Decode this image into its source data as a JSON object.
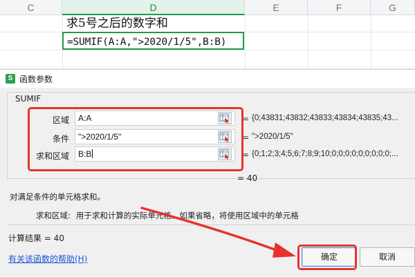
{
  "sheet": {
    "columns": [
      "C",
      "D",
      "E",
      "F",
      "G"
    ],
    "active_column": "D",
    "d1_text": "求5号之后的数字和",
    "d2_formula": "=SUMIF(A:A,\">2020/1/5\",B:B)"
  },
  "dialog": {
    "app_icon_letter": "S",
    "title": "函数参数",
    "function_name": "SUMIF",
    "args": [
      {
        "label": "区域",
        "value": "A:A",
        "preview": "{0;43831;43832;43833;43834;43835;43..."
      },
      {
        "label": "条件",
        "value": "\">2020/1/5\"",
        "preview": "\">2020/1/5\""
      },
      {
        "label": "求和区域",
        "value": "B:B",
        "preview": "{0;1;2;3;4;5;6;7;8;9;10;0;0;0;0;0;0;0;0;0;..."
      }
    ],
    "equals": "=",
    "result_preview": "=  40",
    "description": "对满足条件的单元格求和。",
    "arg_description_label": "求和区域:",
    "arg_description_text": "用于求和计算的实际单元格。如果省略，将使用区域中的单元格",
    "calc_result": "计算结果 =  40",
    "help_link": "有关该函数的帮助(H)",
    "ok_label": "确定",
    "cancel_label": "取消"
  },
  "colors": {
    "accent_green": "#1e9a4b",
    "annotation_red": "#e8322b",
    "link_blue": "#1a55d4"
  }
}
